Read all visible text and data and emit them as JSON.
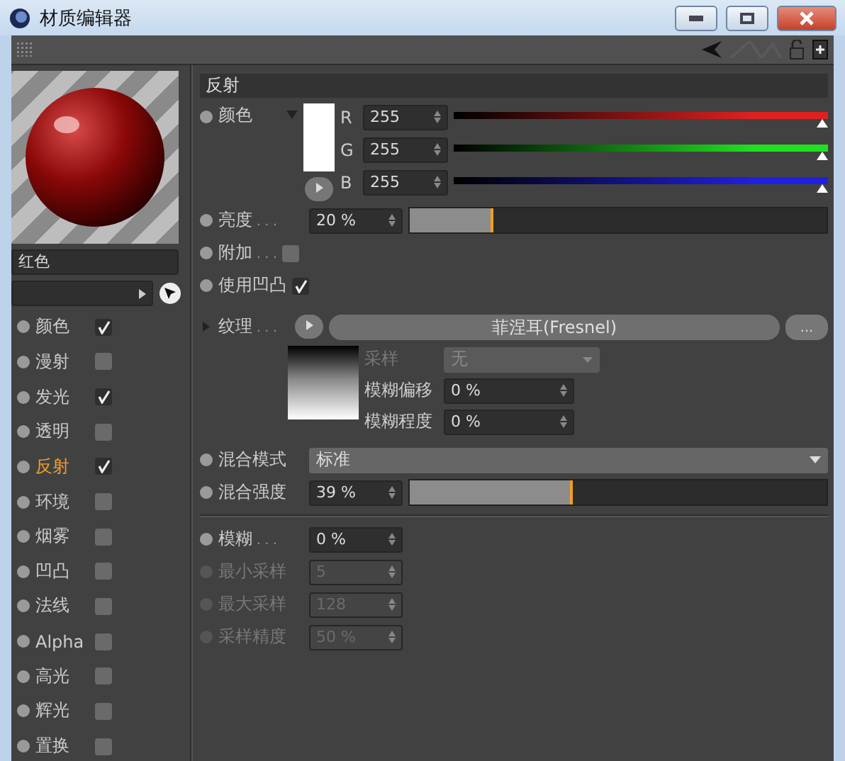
{
  "window": {
    "title": "材质编辑器"
  },
  "material_name": "红色",
  "channels": [
    {
      "label": "颜色",
      "checked": true,
      "selected": false
    },
    {
      "label": "漫射",
      "checked": false,
      "selected": false
    },
    {
      "label": "发光",
      "checked": true,
      "selected": false
    },
    {
      "label": "透明",
      "checked": false,
      "selected": false
    },
    {
      "label": "反射",
      "checked": true,
      "selected": true
    },
    {
      "label": "环境",
      "checked": false,
      "selected": false
    },
    {
      "label": "烟雾",
      "checked": false,
      "selected": false
    },
    {
      "label": "凹凸",
      "checked": false,
      "selected": false
    },
    {
      "label": "法线",
      "checked": false,
      "selected": false
    },
    {
      "label": "Alpha",
      "checked": false,
      "selected": false
    },
    {
      "label": "高光",
      "checked": false,
      "selected": false
    },
    {
      "label": "辉光",
      "checked": false,
      "selected": false
    },
    {
      "label": "置换",
      "checked": false,
      "selected": false
    }
  ],
  "section_title": "反射",
  "color": {
    "label": "颜色",
    "components": [
      {
        "label": "R",
        "value": "255",
        "level": 1.0,
        "color": "#e02020"
      },
      {
        "label": "G",
        "value": "255",
        "level": 1.0,
        "color": "#20e020"
      },
      {
        "label": "B",
        "value": "255",
        "level": 1.0,
        "color": "#2020e0"
      }
    ]
  },
  "brightness": {
    "label": "亮度",
    "dots": ". . .",
    "value": "20 %",
    "level": 0.2
  },
  "options": [
    {
      "label": "附加",
      "dots": ". . .",
      "checked": false
    },
    {
      "label": "使用凹凸",
      "checked": true
    }
  ],
  "texture": {
    "label": "纹理",
    "dots": ". . .",
    "shader": "菲涅耳(Fresnel)",
    "more": "...",
    "fields": [
      {
        "label": "采样",
        "value": "无",
        "kind": "select",
        "disabled": true
      },
      {
        "label": "模糊偏移",
        "value": "0 %",
        "kind": "spin",
        "disabled": false
      },
      {
        "label": "模糊程度",
        "value": "0 %",
        "kind": "spin",
        "disabled": false
      }
    ]
  },
  "blend_mode": {
    "label": "混合模式",
    "value": "标准"
  },
  "blend_strength": {
    "label": "混合强度",
    "value": "39 %",
    "level": 0.39
  },
  "blur_fields": [
    {
      "label": "模糊",
      "dots": ". . .",
      "value": "0 %",
      "disabled": false
    },
    {
      "label": "最小采样",
      "value": "5",
      "disabled": true
    },
    {
      "label": "最大采样",
      "value": "128",
      "disabled": true
    },
    {
      "label": "采样精度",
      "value": "50 %",
      "disabled": true
    }
  ]
}
